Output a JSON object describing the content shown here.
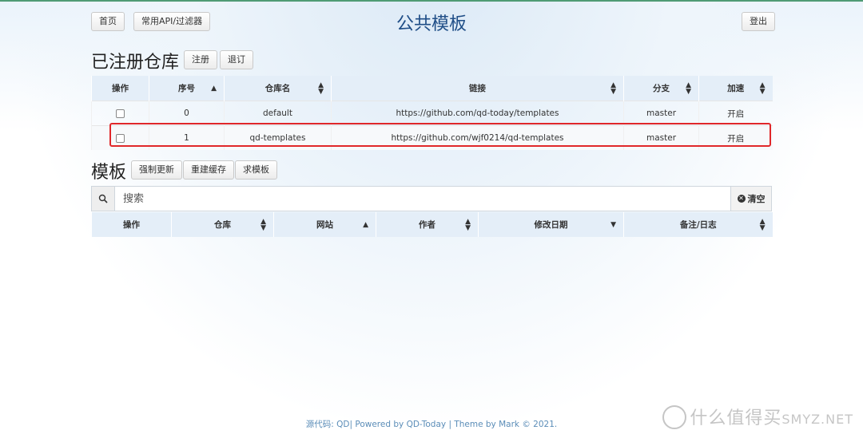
{
  "nav": {
    "home_label": "首页",
    "api_filter_label": "常用API/过滤器",
    "logout_label": "登出"
  },
  "page_title": "公共模板",
  "registered": {
    "title": "已注册仓库",
    "register_label": "注册",
    "unregister_label": "退订",
    "columns": [
      "操作",
      "序号",
      "仓库名",
      "链接",
      "分支",
      "加速"
    ],
    "rows": [
      {
        "index": "0",
        "name": "default",
        "url": "https://github.com/qd-today/templates",
        "branch": "master",
        "accel": "开启"
      },
      {
        "index": "1",
        "name": "qd-templates",
        "url": "https://github.com/wjf0214/qd-templates",
        "branch": "master",
        "accel": "开启"
      }
    ]
  },
  "templates": {
    "title": "模板",
    "force_update_label": "强制更新",
    "rebuild_cache_label": "重建缓存",
    "request_template_label": "求模板",
    "search_placeholder": "搜索",
    "clear_label": "清空",
    "columns": [
      "操作",
      "仓库",
      "网站",
      "作者",
      "修改日期",
      "备注/日志"
    ]
  },
  "footer": {
    "source_label": "源代码: QD",
    "powered": "| Powered by QD-Today | Theme by Mark © 2021."
  },
  "watermark": "什么值得买",
  "watermark_site": "SMYZ.NET",
  "colors": {
    "title_blue": "#1f4e87",
    "header_bg": "#e4eef8",
    "highlight_red": "#e0272a",
    "footer_blue": "#5b8db8"
  }
}
